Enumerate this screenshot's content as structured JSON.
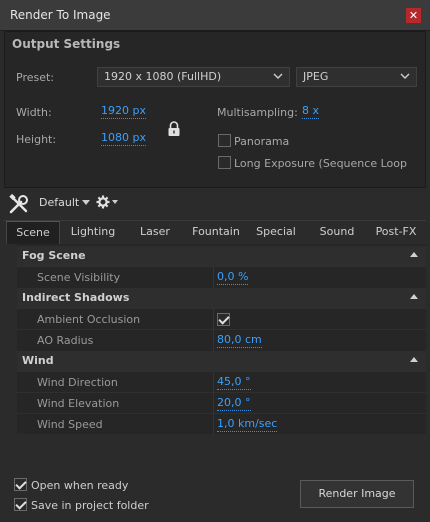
{
  "window": {
    "title": "Render To Image",
    "close_glyph": "✕"
  },
  "output": {
    "heading": "Output Settings",
    "preset_label": "Preset:",
    "preset_value": "1920 x 1080 (FullHD)",
    "format_value": "JPEG",
    "width_label": "Width:",
    "width_value": "1920 px",
    "height_label": "Height:",
    "height_value": "1080 px",
    "multisampling_label": "Multisampling:",
    "multisampling_value": "8 x",
    "panorama_label": "Panorama",
    "long_exposure_label": "Long Exposure (Sequence Loop"
  },
  "toolbar": {
    "preset_name": "Default"
  },
  "tabs": [
    {
      "label": "Scene",
      "active": true
    },
    {
      "label": "Lighting"
    },
    {
      "label": "Laser"
    },
    {
      "label": "Fountain"
    },
    {
      "label": "Special FX"
    },
    {
      "label": "Sound"
    },
    {
      "label": "Post-FX"
    }
  ],
  "groups": {
    "fog": {
      "title": "Fog Scene",
      "scene_visibility_label": "Scene Visibility",
      "scene_visibility_value": "0,0 %"
    },
    "shadows": {
      "title": "Indirect Shadows",
      "ao_label": "Ambient Occlusion",
      "ao_checked": true,
      "ao_radius_label": "AO Radius",
      "ao_radius_value": "80,0 cm"
    },
    "wind": {
      "title": "Wind",
      "direction_label": "Wind Direction",
      "direction_value": "45,0 °",
      "elevation_label": "Wind Elevation",
      "elevation_value": "20,0 °",
      "speed_label": "Wind Speed",
      "speed_value": "1,0 km/sec"
    }
  },
  "bottom": {
    "open_when_ready_label": "Open when ready",
    "save_in_project_label": "Save in project folder",
    "render_button_label": "Render Image"
  },
  "colors": {
    "accent_link": "#3aa0ff",
    "close_red": "#b5282b"
  }
}
